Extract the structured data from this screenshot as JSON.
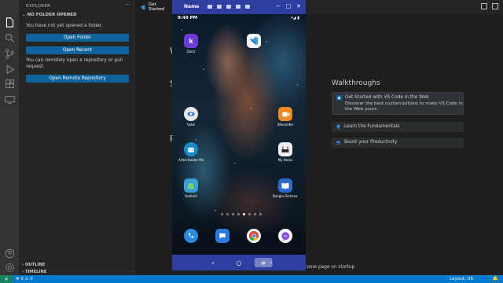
{
  "sidebar": {
    "title": "EXPLORER",
    "more": "···",
    "section": "NO FOLDER OPENED",
    "no_folder_text": "You have not yet opened a folder.",
    "open_folder": "Open Folder",
    "open_recent": "Open Recent",
    "remote_text": "You can remotely open a repository or pull request.",
    "open_remote": "Open Remote Repository",
    "outline": "OUTLINE",
    "timeline": "TIMELINE"
  },
  "editor": {
    "tab_label": "Get Started",
    "walkthroughs_title": "Walkthroughs",
    "walkthroughs": [
      {
        "title": "Get Started with VS Code in the Web",
        "desc": "Discover the best customizations to make VS Code in the Web yours."
      },
      {
        "title": "Learn the Fundamentals"
      },
      {
        "title": "Boost your Productivity"
      }
    ],
    "startup_text": "elcome page on startup"
  },
  "phone": {
    "window_title": "Name",
    "time": "9:49 PM",
    "status_right": "▾◢ ▮",
    "apps": [
      {
        "label": "Quizz",
        "icon": "k",
        "color": "#6a3bd6"
      },
      {
        "label": "",
        "icon": "vscode",
        "color": "#1e6fd0"
      },
      {
        "label": "Vybe",
        "icon": "eye",
        "color": "#e8e8e8"
      },
      {
        "label": "XRecorder",
        "icon": "rec",
        "color": "#f08a1f"
      },
      {
        "label": "Airtel Router Ma...",
        "icon": "robot",
        "color": "#1a8acb"
      },
      {
        "label": "My Netos",
        "icon": "netos",
        "color": "#f0f0f0"
      },
      {
        "label": "Android",
        "icon": "android",
        "color": "#3aa0d8"
      },
      {
        "label": "Bangla Dictionary",
        "icon": "book",
        "color": "#2a6acf"
      },
      {
        "label": "",
        "icon": "phone",
        "color": "#2a8ae0"
      },
      {
        "label": "",
        "icon": "messages",
        "color": "#2a7ae0"
      },
      {
        "label": "",
        "icon": "chrome",
        "color": "#ffffff"
      },
      {
        "label": "",
        "icon": "messenger",
        "color": "#ffffff"
      }
    ],
    "nav": {
      "back": "‹",
      "home": "○",
      "menu": "≡"
    }
  },
  "statusbar": {
    "remote": "✕",
    "errors": "⊗ 0 ⚠ 0",
    "layout": "Layout: US",
    "bell": "🔔"
  },
  "colors": {
    "accent": "#007acc",
    "button": "#0e639c",
    "phone_bar": "#2e3da0"
  }
}
